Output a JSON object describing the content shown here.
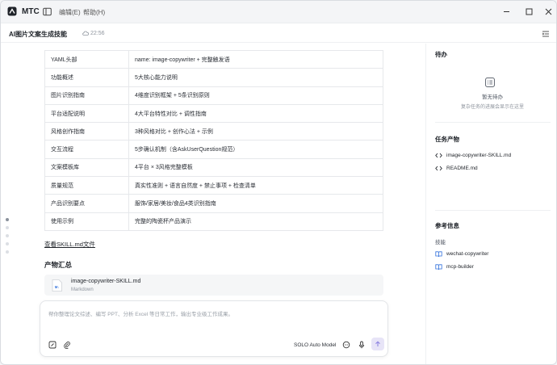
{
  "app": {
    "name": "MTC"
  },
  "menu": {
    "edit": "编辑(E)",
    "help": "帮助(H)"
  },
  "header": {
    "title": "AI图片文案生成技能",
    "time": "22:56"
  },
  "table": {
    "rows": [
      {
        "key": "YAML头部",
        "value": "name: image-copywriter + 完整触发语"
      },
      {
        "key": "功能概述",
        "value": "5大核心能力说明"
      },
      {
        "key": "图片识别指南",
        "value": "4维度识别框架 + 5条识别原则"
      },
      {
        "key": "平台适配说明",
        "value": "4大平台特性对比 + 调性指南"
      },
      {
        "key": "风格创作指南",
        "value": "3种风格对比 + 创作心法 + 示例"
      },
      {
        "key": "交互流程",
        "value": "5步确认机制（含AskUserQuestion规范）"
      },
      {
        "key": "文案模板库",
        "value": "4平台 × 3风格完整模板"
      },
      {
        "key": "质量规范",
        "value": "真实性准则 + 语言自然度 + 禁止事项 + 检查清单"
      },
      {
        "key": "产品识别要点",
        "value": "服饰/家居/美妆/食品4类识别指南"
      },
      {
        "key": "使用示例",
        "value": "完整的陶瓷杯产品演示"
      }
    ]
  },
  "main": {
    "view_link": "查看SKILL.md文件",
    "section_title": "产物汇总",
    "file": {
      "name": "image-copywriter-SKILL.md",
      "type": "Markdown"
    }
  },
  "composer": {
    "placeholder": "帮你整理论文综述、编写 PPT、分析 Excel 等日常工作，输出专业级工作成果。",
    "model": "SOLO Auto Model"
  },
  "right_panel": {
    "todo": {
      "title": "待办",
      "empty_title": "暂无待办",
      "empty_desc": "复杂任务的进展会显示在这里"
    },
    "artifacts": {
      "title": "任务产物",
      "items": [
        "image-copywriter-SKILL.md",
        "README.md"
      ]
    },
    "reference": {
      "title": "参考信息",
      "skills_label": "技能",
      "skills": [
        "wechat-copywriter",
        "mcp-builder"
      ]
    }
  },
  "colors": {
    "accent": "#7b6fd6",
    "send_bg": "#e7e4f7",
    "skill_icon": "#2f6fdb"
  }
}
